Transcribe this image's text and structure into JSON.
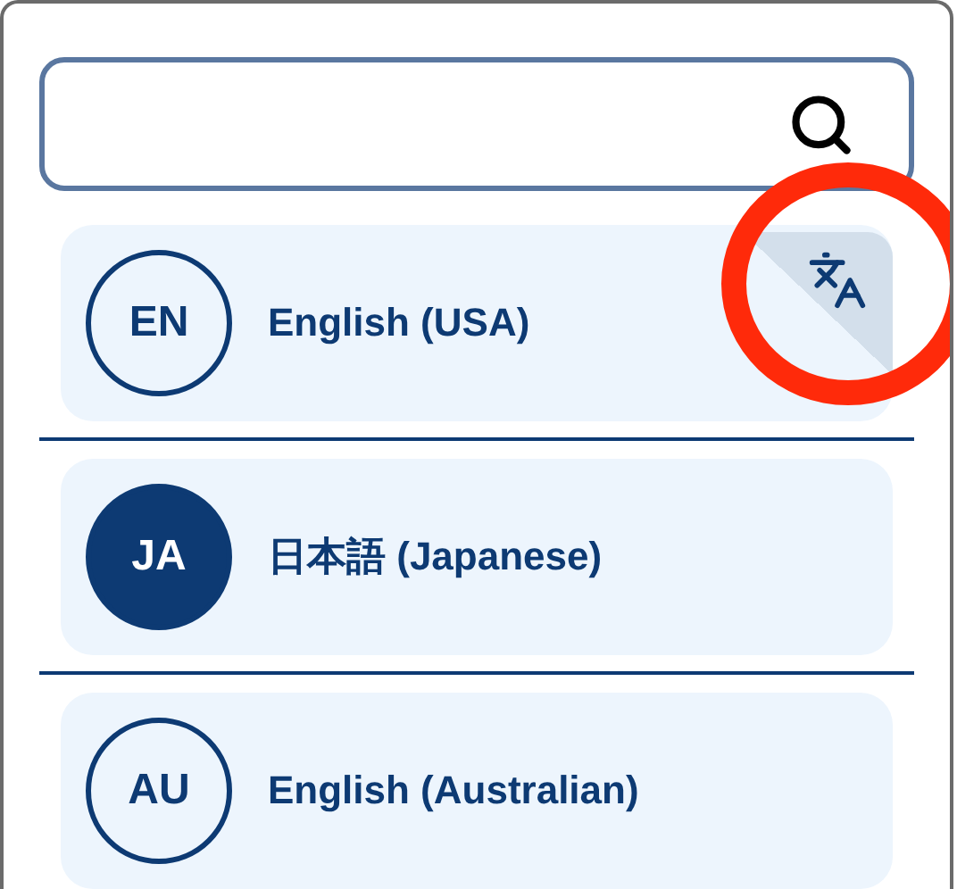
{
  "languages": [
    {
      "code": "EN",
      "name": "English (USA)",
      "selected": false,
      "translated": true,
      "highlighted": true
    },
    {
      "code": "JA",
      "name": "日本語 (Japanese)",
      "selected": true,
      "translated": false,
      "highlighted": false
    },
    {
      "code": "AU",
      "name": "English (Australian)",
      "selected": false,
      "translated": false,
      "highlighted": false
    }
  ]
}
